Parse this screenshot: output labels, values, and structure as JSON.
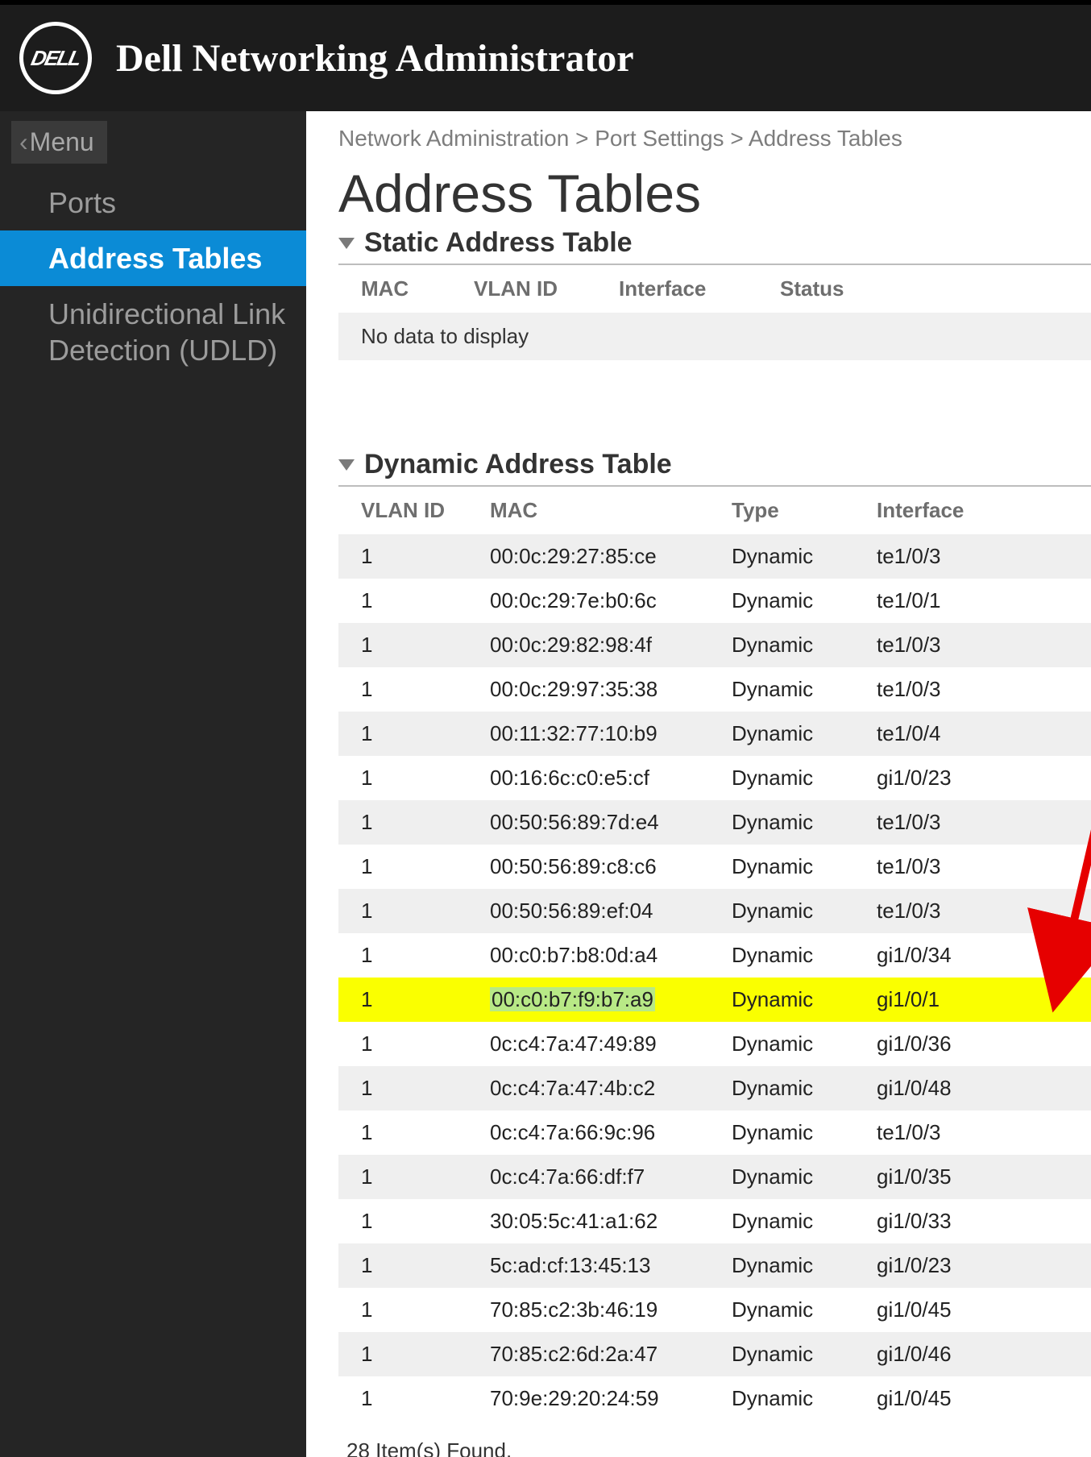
{
  "header": {
    "logo_text": "DELL",
    "title": "Dell Networking Administrator"
  },
  "sidebar": {
    "menu_back_label": "Menu",
    "items": [
      {
        "label": "Ports",
        "active": false
      },
      {
        "label": "Address Tables",
        "active": true
      },
      {
        "label": "Unidirectional Link Detection (UDLD)",
        "active": false
      }
    ]
  },
  "breadcrumb": {
    "parts": [
      "Network Administration",
      "Port Settings",
      "Address Tables"
    ],
    "sep": " > "
  },
  "page_title": "Address Tables",
  "static_table": {
    "title": "Static Address Table",
    "columns": [
      "MAC",
      "VLAN ID",
      "Interface",
      "Status"
    ],
    "no_data": "No data to display"
  },
  "dynamic_table": {
    "title": "Dynamic Address Table",
    "columns": [
      "VLAN ID",
      "MAC",
      "Type",
      "Interface"
    ],
    "highlight_index": 10,
    "rows": [
      {
        "vlan": "1",
        "mac": "00:0c:29:27:85:ce",
        "type": "Dynamic",
        "iface": "te1/0/3"
      },
      {
        "vlan": "1",
        "mac": "00:0c:29:7e:b0:6c",
        "type": "Dynamic",
        "iface": "te1/0/1"
      },
      {
        "vlan": "1",
        "mac": "00:0c:29:82:98:4f",
        "type": "Dynamic",
        "iface": "te1/0/3"
      },
      {
        "vlan": "1",
        "mac": "00:0c:29:97:35:38",
        "type": "Dynamic",
        "iface": "te1/0/3"
      },
      {
        "vlan": "1",
        "mac": "00:11:32:77:10:b9",
        "type": "Dynamic",
        "iface": "te1/0/4"
      },
      {
        "vlan": "1",
        "mac": "00:16:6c:c0:e5:cf",
        "type": "Dynamic",
        "iface": "gi1/0/23"
      },
      {
        "vlan": "1",
        "mac": "00:50:56:89:7d:e4",
        "type": "Dynamic",
        "iface": "te1/0/3"
      },
      {
        "vlan": "1",
        "mac": "00:50:56:89:c8:c6",
        "type": "Dynamic",
        "iface": "te1/0/3"
      },
      {
        "vlan": "1",
        "mac": "00:50:56:89:ef:04",
        "type": "Dynamic",
        "iface": "te1/0/3"
      },
      {
        "vlan": "1",
        "mac": "00:c0:b7:b8:0d:a4",
        "type": "Dynamic",
        "iface": "gi1/0/34"
      },
      {
        "vlan": "1",
        "mac": "00:c0:b7:f9:b7:a9",
        "type": "Dynamic",
        "iface": "gi1/0/1"
      },
      {
        "vlan": "1",
        "mac": "0c:c4:7a:47:49:89",
        "type": "Dynamic",
        "iface": "gi1/0/36"
      },
      {
        "vlan": "1",
        "mac": "0c:c4:7a:47:4b:c2",
        "type": "Dynamic",
        "iface": "gi1/0/48"
      },
      {
        "vlan": "1",
        "mac": "0c:c4:7a:66:9c:96",
        "type": "Dynamic",
        "iface": "te1/0/3"
      },
      {
        "vlan": "1",
        "mac": "0c:c4:7a:66:df:f7",
        "type": "Dynamic",
        "iface": "gi1/0/35"
      },
      {
        "vlan": "1",
        "mac": "30:05:5c:41:a1:62",
        "type": "Dynamic",
        "iface": "gi1/0/33"
      },
      {
        "vlan": "1",
        "mac": "5c:ad:cf:13:45:13",
        "type": "Dynamic",
        "iface": "gi1/0/23"
      },
      {
        "vlan": "1",
        "mac": "70:85:c2:3b:46:19",
        "type": "Dynamic",
        "iface": "gi1/0/45"
      },
      {
        "vlan": "1",
        "mac": "70:85:c2:6d:2a:47",
        "type": "Dynamic",
        "iface": "gi1/0/46"
      },
      {
        "vlan": "1",
        "mac": "70:9e:29:20:24:59",
        "type": "Dynamic",
        "iface": "gi1/0/45"
      }
    ],
    "footer": "28 Item(s) Found."
  },
  "annotation": {
    "arrow_color": "#e60000"
  }
}
